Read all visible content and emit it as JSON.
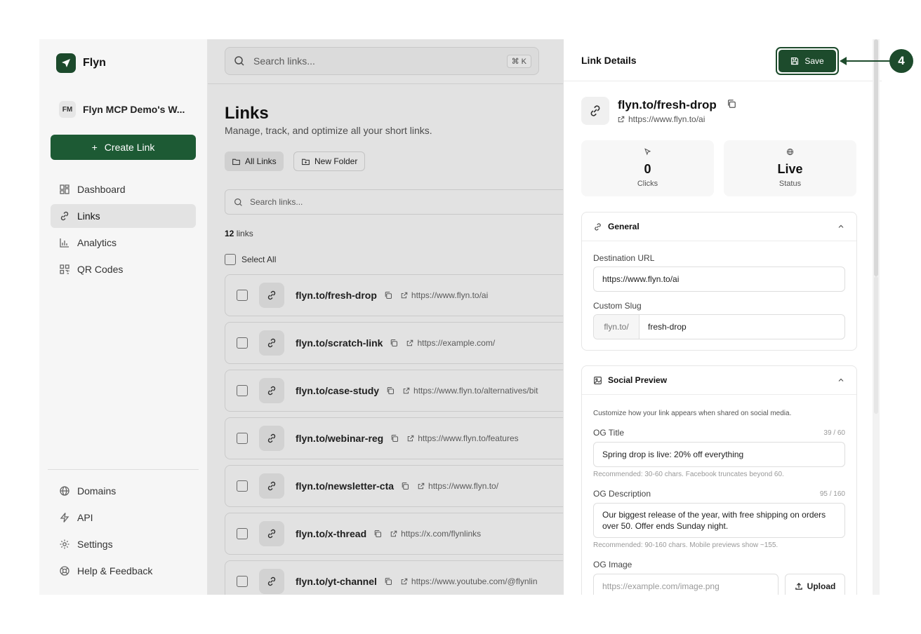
{
  "app": {
    "name": "Flyn"
  },
  "workspace": {
    "initials": "FM",
    "name": "Flyn MCP Demo's W..."
  },
  "sidebar": {
    "create_label": "Create Link",
    "nav": [
      {
        "label": "Dashboard"
      },
      {
        "label": "Links"
      },
      {
        "label": "Analytics"
      },
      {
        "label": "QR Codes"
      }
    ],
    "bottom": [
      {
        "label": "Domains"
      },
      {
        "label": "API"
      },
      {
        "label": "Settings"
      },
      {
        "label": "Help & Feedback"
      }
    ]
  },
  "topbar": {
    "search_placeholder": "Search links...",
    "shortcut": "⌘ K"
  },
  "main": {
    "title": "Links",
    "subtitle": "Manage, track, and optimize all your short links.",
    "chips": {
      "all": "All Links",
      "new_folder": "New Folder"
    },
    "list_search_placeholder": "Search links...",
    "count_number": "12",
    "count_label": " links",
    "select_all": "Select All",
    "rows": [
      {
        "slug": "flyn.to/fresh-drop",
        "url": "https://www.flyn.to/ai"
      },
      {
        "slug": "flyn.to/scratch-link",
        "url": "https://example.com/"
      },
      {
        "slug": "flyn.to/case-study",
        "url": "https://www.flyn.to/alternatives/bit"
      },
      {
        "slug": "flyn.to/webinar-reg",
        "url": "https://www.flyn.to/features"
      },
      {
        "slug": "flyn.to/newsletter-cta",
        "url": "https://www.flyn.to/"
      },
      {
        "slug": "flyn.to/x-thread",
        "url": "https://x.com/flynlinks"
      },
      {
        "slug": "flyn.to/yt-channel",
        "url": "https://www.youtube.com/@flynlin"
      }
    ]
  },
  "panel": {
    "title": "Link Details",
    "save_label": "Save",
    "slug": "flyn.to/fresh-drop",
    "url": "https://www.flyn.to/ai",
    "stats": {
      "clicks_value": "0",
      "clicks_label": "Clicks",
      "status_value": "Live",
      "status_label": "Status"
    },
    "general": {
      "title": "General",
      "dest_label": "Destination URL",
      "dest_value": "https://www.flyn.to/ai",
      "slug_label": "Custom Slug",
      "slug_prefix": "flyn.to/",
      "slug_value": "fresh-drop"
    },
    "social": {
      "title": "Social Preview",
      "helper": "Customize how your link appears when shared on social media.",
      "og_title_label": "OG Title",
      "og_title_count": "39 / 60",
      "og_title_value": "Spring drop is live: 20% off everything",
      "og_title_hint": "Recommended: 30-60 chars. Facebook truncates beyond 60.",
      "og_desc_label": "OG Description",
      "og_desc_count": "95 / 160",
      "og_desc_value": "Our biggest release of the year, with free shipping on orders over 50. Offer ends Sunday night.",
      "og_desc_hint": "Recommended: 90-160 chars. Mobile previews show ~155.",
      "og_image_label": "OG Image",
      "og_image_placeholder": "https://example.com/image.png",
      "upload_label": "Upload"
    }
  },
  "annotation": {
    "step": "4"
  },
  "colors": {
    "brand": "#1d4b2c",
    "create": "#1d5a34"
  }
}
